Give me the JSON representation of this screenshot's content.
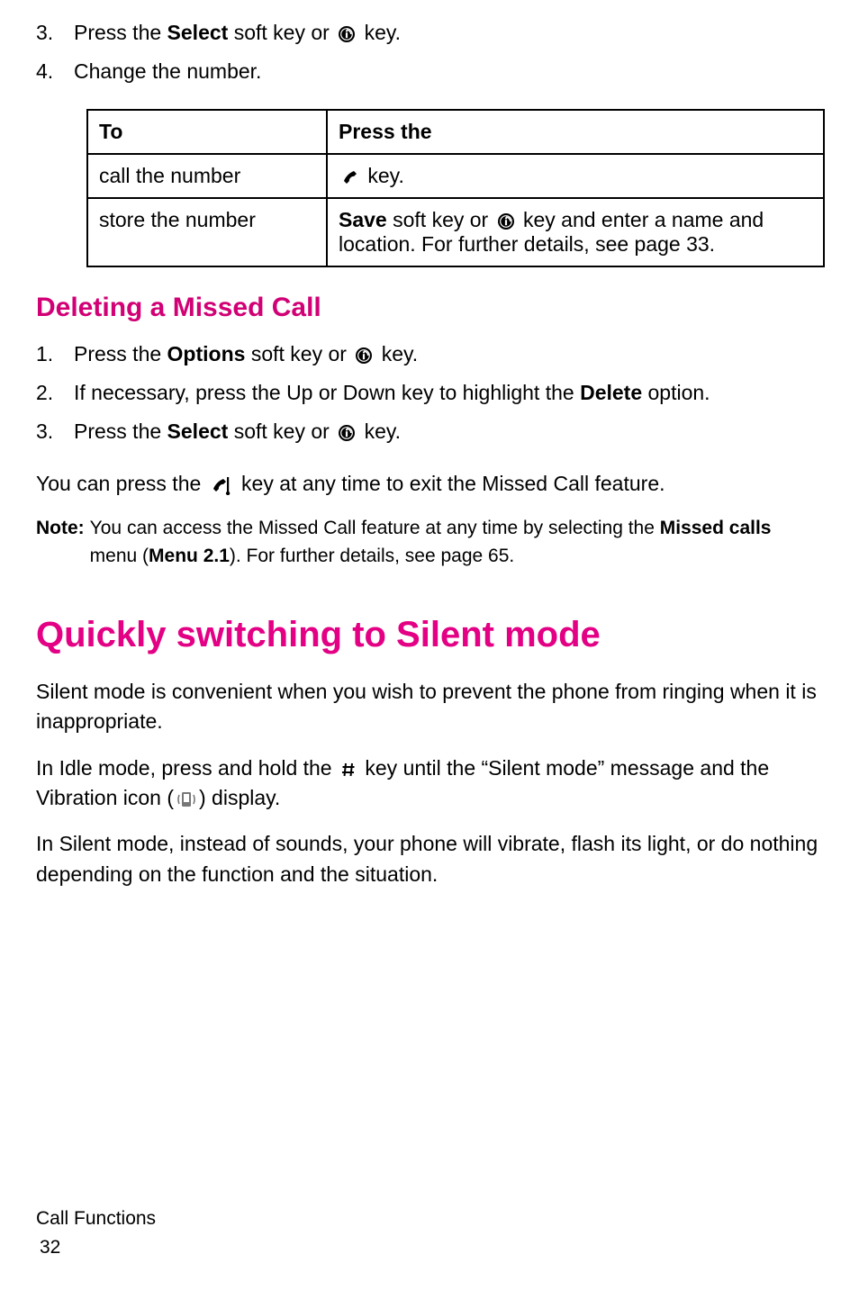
{
  "steps_top": [
    {
      "num": "3.",
      "before": "Press the ",
      "bold": "Select",
      "after": " soft key or ",
      "icon": "i-key",
      "tail": " key."
    },
    {
      "num": "4.",
      "before": "Change the number.",
      "bold": "",
      "after": "",
      "icon": "",
      "tail": ""
    }
  ],
  "table": {
    "head_to": "To",
    "head_press": "Press the",
    "row1_to": "call the number",
    "row1_press_tail": " key.",
    "row2_to": "store the number",
    "row2_bold": "Save",
    "row2_after_bold": " soft key or ",
    "row2_tail": " key and enter a name and location. For further details, see page 33."
  },
  "heading2": "Deleting a Missed Call",
  "steps_del": [
    {
      "num": "1.",
      "before": "Press the ",
      "bold": "Options",
      "after": " soft key or ",
      "icon": "i-key",
      "tail": " key."
    },
    {
      "num": "2.",
      "before": "If necessary, press the Up or Down key to highlight the ",
      "bold": "Delete",
      "after": " option.",
      "icon": "",
      "tail": ""
    },
    {
      "num": "3.",
      "before": "Press the ",
      "bold": "Select",
      "after": " soft key or ",
      "icon": "i-key",
      "tail": " key."
    }
  ],
  "after_del_before": "You can press the ",
  "after_del_tail": " key at any time to exit the Missed Call feature.",
  "note_label": "Note:",
  "note_before": " You can access the Missed Call feature at any time by selecting the ",
  "note_bold1": "Missed calls",
  "note_mid": " menu (",
  "note_bold2": "Menu 2.1",
  "note_after": "). For further details, see page 65.",
  "heading1": "Quickly switching to Silent mode",
  "silent_p1": "Silent mode is convenient when you wish to prevent the phone from ringing when it is inappropriate.",
  "silent_p2_before": "In Idle mode, press and hold the ",
  "silent_p2_mid": " key until the “Silent mode” message and the Vibration icon (",
  "silent_p2_after": ") display.",
  "silent_p3": "In Silent mode, instead of sounds, your phone will vibrate, flash its light, or do nothing depending on the function and the situation.",
  "footer_section": "Call Functions",
  "footer_page": "32"
}
